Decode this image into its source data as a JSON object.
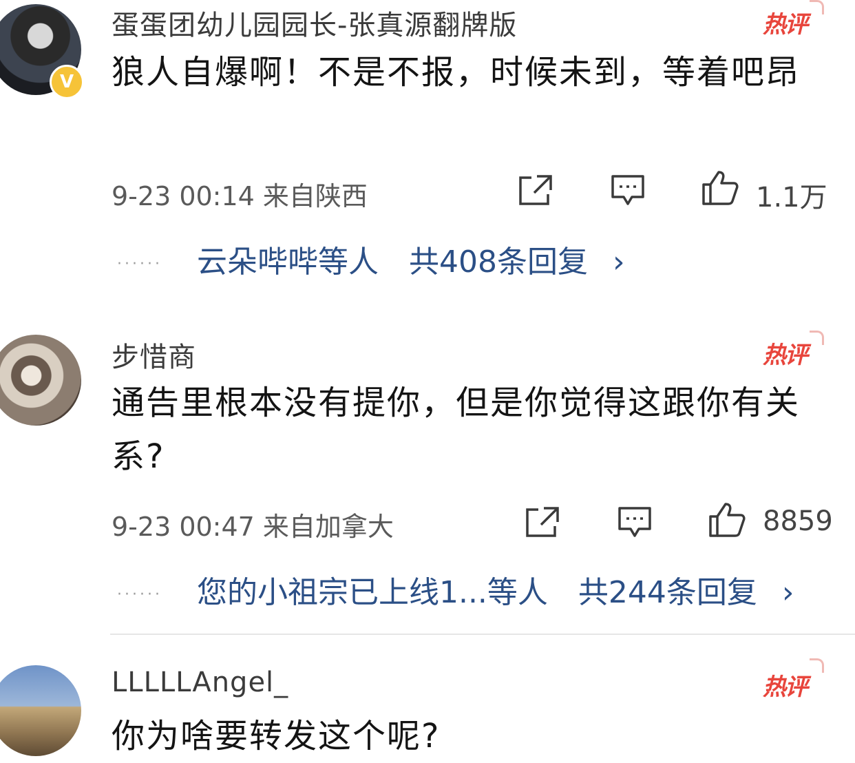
{
  "comments": [
    {
      "username": "蛋蛋团幼儿园园长-张真源翻牌版",
      "hot_tag": "热评",
      "verified_badge": "V",
      "content": "狼人自爆啊！不是不报，时候未到，等着吧昂",
      "meta": "9-23 00:14  来自陕西",
      "likes": "1.1万",
      "replies_preview": "云朵哔哔等人",
      "replies_total": "共408条回复",
      "chevron": "›"
    },
    {
      "username": "步惜商",
      "hot_tag": "热评",
      "content": "通告里根本没有提你，但是你觉得这跟你有关系?",
      "meta": "9-23 00:47  来自加拿大",
      "likes": "8859",
      "replies_preview": "您的小祖宗已上线1...等人",
      "replies_total": "共244条回复",
      "chevron": "›"
    },
    {
      "username": "LLLLLAngel_",
      "hot_tag": "热评",
      "content": "你为啥要转发这个呢?"
    }
  ],
  "dots": "······",
  "colors": {
    "hot": "#e8453c",
    "reply_link": "#2b4f86",
    "verified": "#f6c338"
  },
  "icons": [
    "share-icon",
    "comment-icon",
    "like-icon",
    "verified-icon"
  ]
}
